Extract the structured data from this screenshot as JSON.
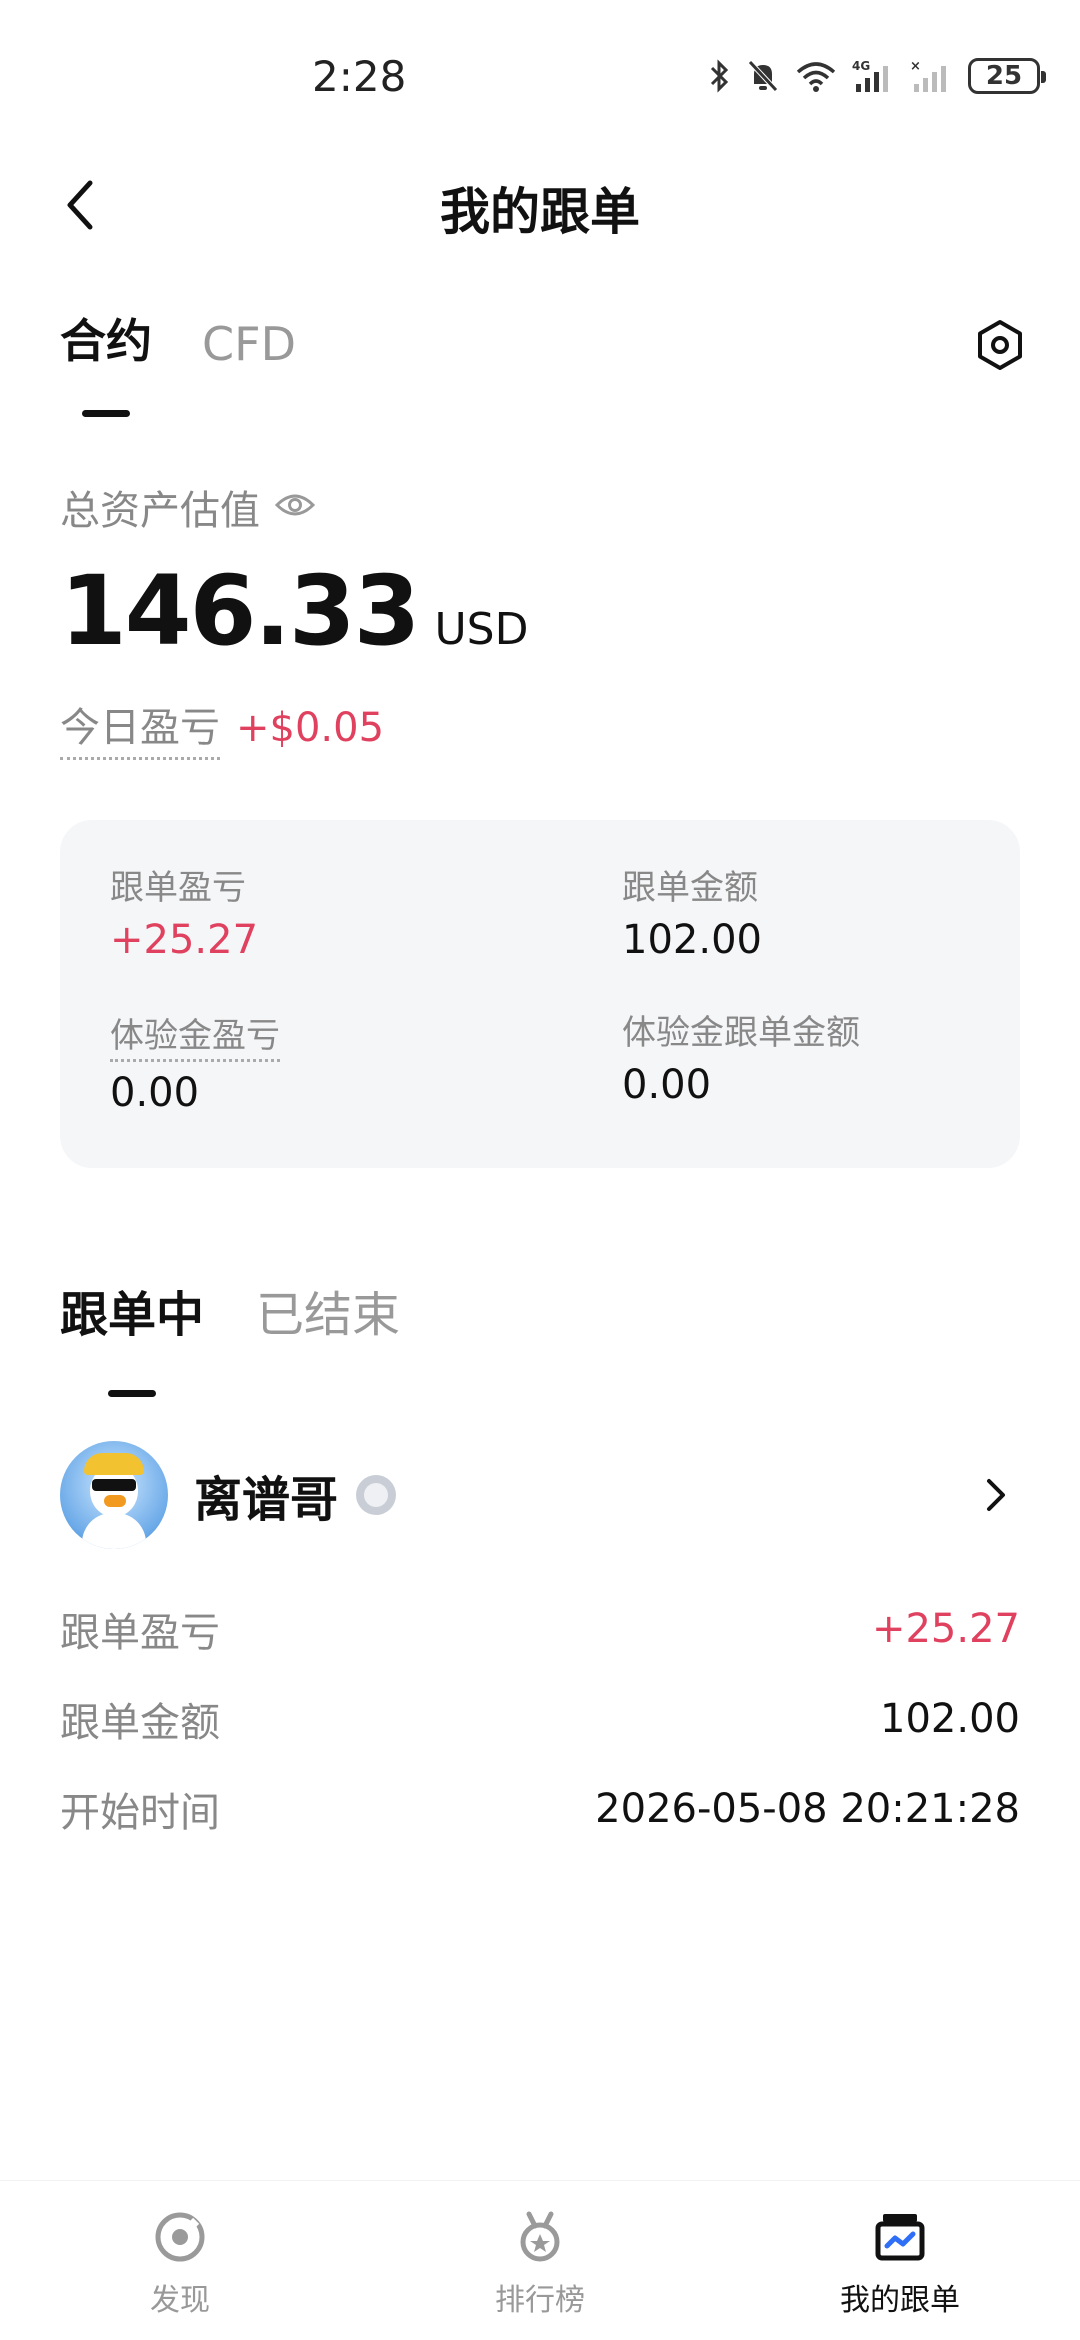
{
  "status_bar": {
    "time": "2:28",
    "battery": "25",
    "network": "4G"
  },
  "header": {
    "title": "我的跟单"
  },
  "top_tabs": [
    {
      "label": "合约",
      "active": true
    },
    {
      "label": "CFD",
      "active": false
    }
  ],
  "assets": {
    "label": "总资产估值",
    "value": "146.33",
    "currency": "USD",
    "today_label": "今日盈亏",
    "today_value": "+$0.05"
  },
  "stats": {
    "copy_pnl_label": "跟单盈亏",
    "copy_pnl_value": "+25.27",
    "copy_amount_label": "跟单金额",
    "copy_amount_value": "102.00",
    "trial_pnl_label": "体验金盈亏",
    "trial_pnl_value": "0.00",
    "trial_amount_label": "体验金跟单金额",
    "trial_amount_value": "0.00"
  },
  "sub_tabs": [
    {
      "label": "跟单中",
      "active": true
    },
    {
      "label": "已结束",
      "active": false
    }
  ],
  "trader": {
    "name": "离谱哥",
    "pnl_label": "跟单盈亏",
    "pnl_value": "+25.27",
    "amount_label": "跟单金额",
    "amount_value": "102.00",
    "start_label": "开始时间",
    "start_value": "2026-05-08 20:21:28"
  },
  "bottom_nav": [
    {
      "label": "发现",
      "icon": "discover-icon",
      "active": false
    },
    {
      "label": "排行榜",
      "icon": "ranking-icon",
      "active": false
    },
    {
      "label": "我的跟单",
      "icon": "my-copy-trade-icon",
      "active": true
    }
  ],
  "colors": {
    "profit_red": "#e0415f",
    "card_bg": "#f5f6f8",
    "text_primary": "#111111",
    "text_secondary": "#888888"
  }
}
